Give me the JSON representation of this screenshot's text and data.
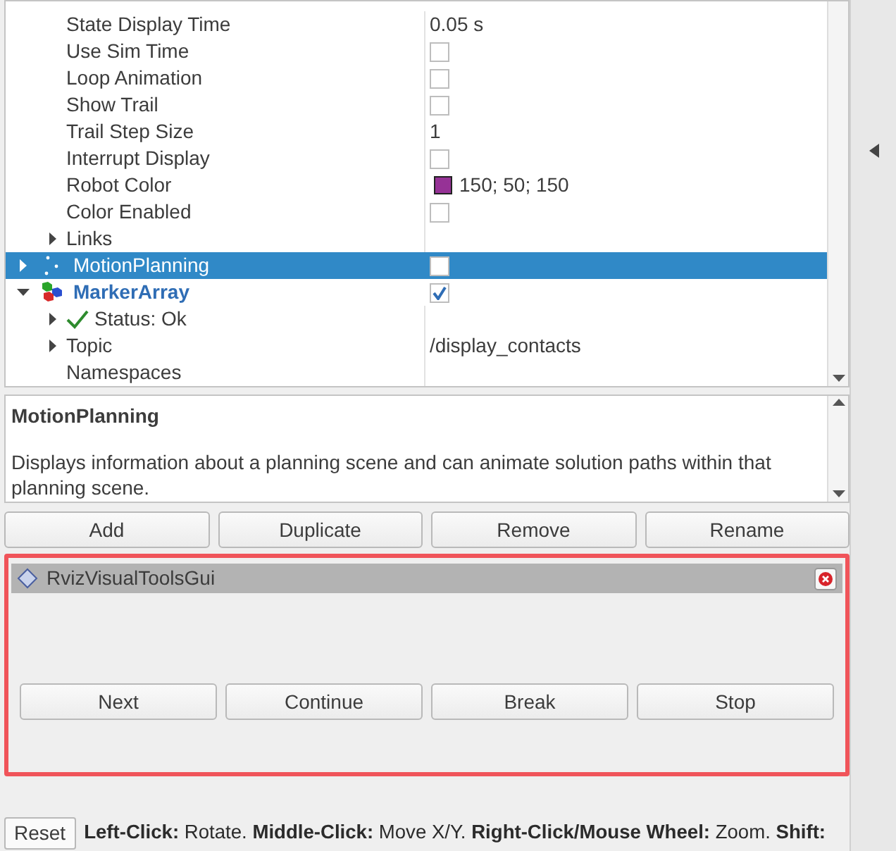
{
  "tree": {
    "rows": [
      {
        "kind": "text",
        "label": "State Display Time",
        "value": "0.05 s"
      },
      {
        "kind": "checkbox",
        "label": "Use Sim Time",
        "checked": false
      },
      {
        "kind": "checkbox",
        "label": "Loop Animation",
        "checked": false
      },
      {
        "kind": "checkbox",
        "label": "Show Trail",
        "checked": false
      },
      {
        "kind": "text",
        "label": "Trail Step Size",
        "value": "1"
      },
      {
        "kind": "checkbox",
        "label": "Interrupt Display",
        "checked": false
      },
      {
        "kind": "color",
        "label": "Robot Color",
        "color": "#963296",
        "value": "150; 50; 150"
      },
      {
        "kind": "checkbox",
        "label": "Color Enabled",
        "checked": false
      },
      {
        "kind": "group",
        "label": "Links",
        "expanded": false
      }
    ],
    "displays": [
      {
        "name": "MotionPlanning",
        "selected": true,
        "expanded": false,
        "checked": false
      },
      {
        "name": "MarkerArray",
        "selected": false,
        "expanded": true,
        "checked": true,
        "children": [
          {
            "kind": "status",
            "label": "Status: Ok",
            "expanded": false
          },
          {
            "kind": "group",
            "label": "Topic",
            "expanded": false,
            "value": "/display_contacts"
          },
          {
            "kind": "plain",
            "label": "Namespaces"
          }
        ]
      }
    ]
  },
  "description": {
    "title": "MotionPlanning",
    "text": "Displays information about a planning scene and can animate solution paths within that planning scene."
  },
  "display_buttons": [
    "Add",
    "Duplicate",
    "Remove",
    "Rename"
  ],
  "panel": {
    "title": "RvizVisualToolsGui",
    "highlighted": true,
    "buttons": [
      "Next",
      "Continue",
      "Break",
      "Stop"
    ]
  },
  "status_bar": {
    "reset": "Reset",
    "help": "**Left-Click:** Rotate. **Middle-Click:** Move X/Y. **Right-Click/Mouse Wheel:** Zoom. **Shift:**"
  }
}
